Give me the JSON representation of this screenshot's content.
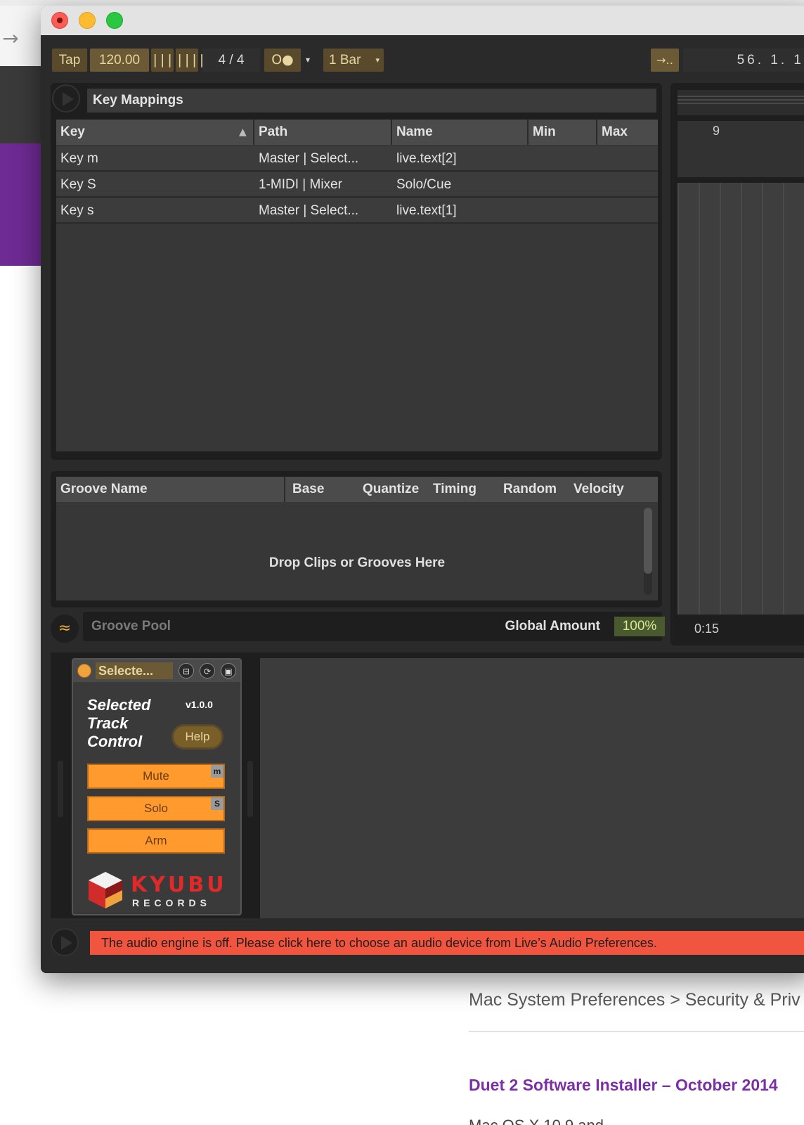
{
  "background": {
    "arrow": "→",
    "breadcrumb": "Mac System Preferences > Security & Priv",
    "link_title": "Duet 2 Software Installer – October 2014",
    "cut_text": "Mac OS X 10.9 and"
  },
  "transport": {
    "tap": "Tap",
    "tempo": "120.00",
    "nudge_down": "||||",
    "nudge_up": "||||",
    "time_signature": "4 / 4",
    "metronome": "O●",
    "metronome_arrow": "▾",
    "quantization": "1 Bar",
    "quantization_arrow": "▾",
    "follow": "→‥",
    "position": "56. 1. 1"
  },
  "key_mappings": {
    "title": "Key Mappings",
    "sort_indicator": "▲",
    "columns": [
      "Key",
      "Path",
      "Name",
      "Min",
      "Max"
    ],
    "rows": [
      {
        "key": "Key m",
        "path": "Master | Select...",
        "name": "live.text[2]",
        "min": "",
        "max": ""
      },
      {
        "key": "Key S",
        "path": "1-MIDI | Mixer",
        "name": "Solo/Cue",
        "min": "",
        "max": ""
      },
      {
        "key": "Key s",
        "path": "Master | Select...",
        "name": "live.text[1]",
        "min": "",
        "max": ""
      }
    ]
  },
  "groove_pool": {
    "columns": [
      "Groove Name",
      "Base",
      "Quantize",
      "Timing",
      "Random",
      "Velocity"
    ],
    "drop_text": "Drop Clips or Grooves Here",
    "label": "Groove Pool",
    "icon": "≈",
    "global_amount_label": "Global Amount",
    "global_amount_value": "100%"
  },
  "arrangement": {
    "bar_marker": "9",
    "time_marker": "0:15"
  },
  "device": {
    "title": "Selecte...",
    "icons": [
      "⊟",
      "⟳",
      "▣"
    ],
    "name_lines": [
      "Selected",
      "Track",
      "Control"
    ],
    "version": "v1.0.0",
    "help": "Help",
    "buttons": [
      {
        "label": "Mute",
        "key": "m"
      },
      {
        "label": "Solo",
        "key": "S"
      },
      {
        "label": "Arm",
        "key": ""
      }
    ],
    "logo_text": "KYUBU",
    "logo_sub": "RECORDS"
  },
  "status": {
    "message": "The audio engine is off. Please click here to choose an audio device from Live’s Audio Preferences."
  },
  "colors": {
    "accent_orange": "#ff9a2e",
    "status_red": "#f2553f",
    "panel_dark": "#1e1e1e",
    "brand_purple": "#6e2b93"
  }
}
